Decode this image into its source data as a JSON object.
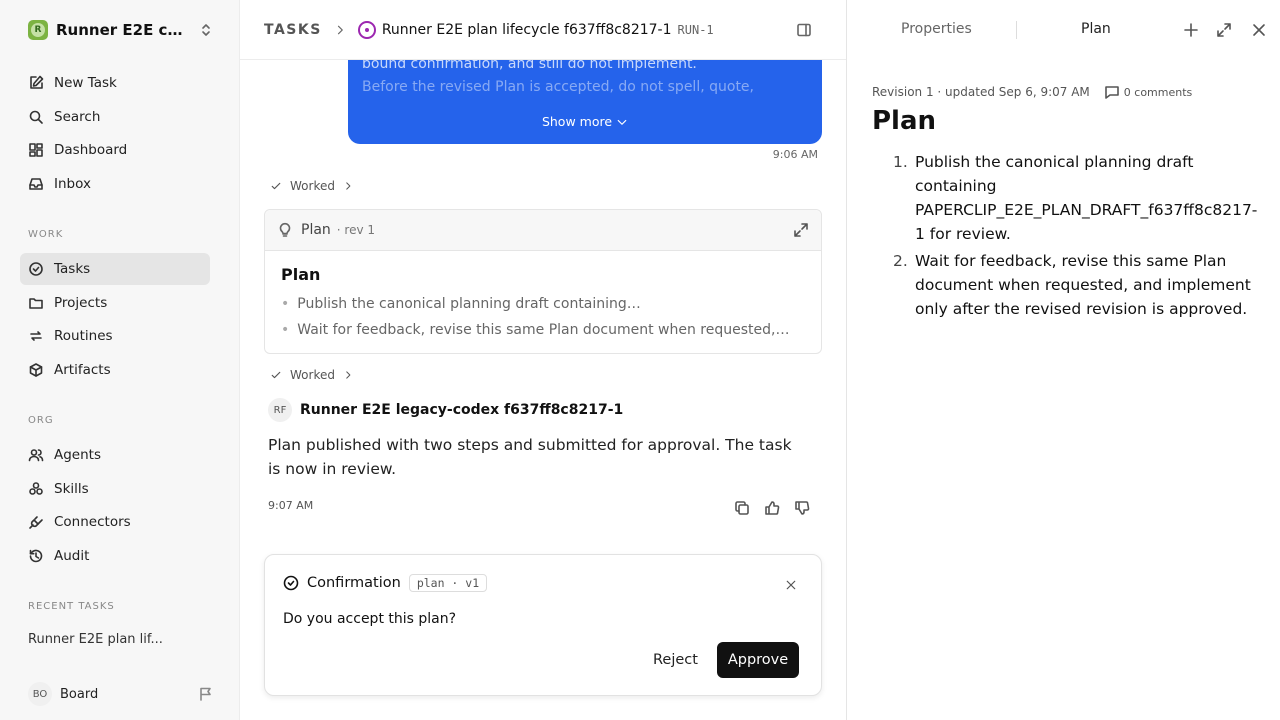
{
  "workspace": {
    "logo_letter": "R",
    "name": "Runner E2E co..."
  },
  "nav": {
    "new_task": "New Task",
    "search": "Search",
    "dashboard": "Dashboard",
    "inbox": "Inbox",
    "section_work": "WORK",
    "tasks": "Tasks",
    "projects": "Projects",
    "routines": "Routines",
    "artifacts": "Artifacts",
    "section_org": "ORG",
    "agents": "Agents",
    "skills": "Skills",
    "connectors": "Connectors",
    "audit": "Audit",
    "section_recent": "RECENT TASKS",
    "recent_task": "Runner E2E plan lif..."
  },
  "user": {
    "initials": "BO",
    "name": "Board"
  },
  "header": {
    "crumb": "TASKS",
    "task_title": "Runner E2E plan lifecycle f637ff8c8217-1",
    "run_id": "RUN-1"
  },
  "message": {
    "line1": "bound confirmation, and still do not implement.",
    "line2": "Before the revised Plan is accepted, do not spell, quote,",
    "show_more": "Show more",
    "time": "9:06 AM"
  },
  "worked_label": "Worked",
  "plan_card": {
    "name": "Plan",
    "rev": "· rev 1",
    "title": "Plan",
    "items": [
      "Publish the canonical planning draft containing…",
      "Wait for feedback, revise this same Plan document when requested,…"
    ]
  },
  "agent": {
    "initials": "RF",
    "name": "Runner E2E legacy-codex f637ff8c8217-1",
    "text": "Plan published with two steps and submitted for approval. The task is now in review.",
    "time": "9:07 AM"
  },
  "confirmation": {
    "title": "Confirmation",
    "tag": "plan · v1",
    "question": "Do you accept this plan?",
    "reject": "Reject",
    "approve": "Approve"
  },
  "panel": {
    "tab_properties": "Properties",
    "tab_plan": "Plan",
    "meta": "Revision 1 · updated Sep 6, 9:07 AM",
    "comments": "0 comments",
    "title": "Plan",
    "steps": [
      {
        "num": "1.",
        "text": "Publish the canonical planning draft containing PAPERCLIP_E2E_PLAN_DRAFT_f637ff8c8217-1 for review."
      },
      {
        "num": "2.",
        "text": "Wait for feedback, revise this same Plan document when requested, and implement only after the revised revision is approved."
      }
    ]
  },
  "icons": {
    "new_task": "edit-icon",
    "search": "search-icon",
    "dashboard": "dashboard-icon",
    "inbox": "inbox-icon",
    "tasks": "check-circle-icon",
    "projects": "folder-icon",
    "routines": "repeat-icon",
    "artifacts": "box-icon",
    "agents": "users-icon",
    "skills": "skills-icon",
    "connectors": "plug-icon",
    "audit": "history-icon"
  },
  "colors": {
    "accent_blue": "#2563eb",
    "task_purple": "#9c27b0",
    "workspace_green": "#7cb342"
  }
}
